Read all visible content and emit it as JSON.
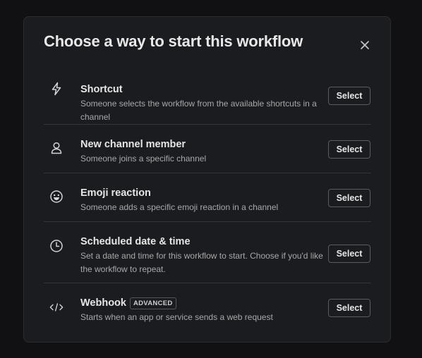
{
  "modal": {
    "title": "Choose a way to start this workflow",
    "close_icon": "close-icon"
  },
  "options": [
    {
      "icon": "lightning-bolt-icon",
      "title": "Shortcut",
      "description": "Someone selects the workflow from the available shortcuts in a channel",
      "button_label": "Select"
    },
    {
      "icon": "person-icon",
      "title": "New channel member",
      "description": "Someone joins a specific channel",
      "button_label": "Select"
    },
    {
      "icon": "emoji-icon",
      "title": "Emoji reaction",
      "description": "Someone adds a specific emoji reaction in a channel",
      "button_label": "Select"
    },
    {
      "icon": "clock-icon",
      "title": "Scheduled date & time",
      "description": "Set a date and time for this workflow to start. Choose if you'd like the workflow to repeat.",
      "button_label": "Select"
    },
    {
      "icon": "code-icon",
      "title": "Webhook",
      "badge": "ADVANCED",
      "description": "Starts when an app or service sends a web request",
      "button_label": "Select"
    }
  ],
  "colors": {
    "modal_background": "#1b1c1f",
    "text_primary": "#e6e6e6",
    "text_secondary": "#a8a8ab",
    "divider": "#34353a"
  }
}
